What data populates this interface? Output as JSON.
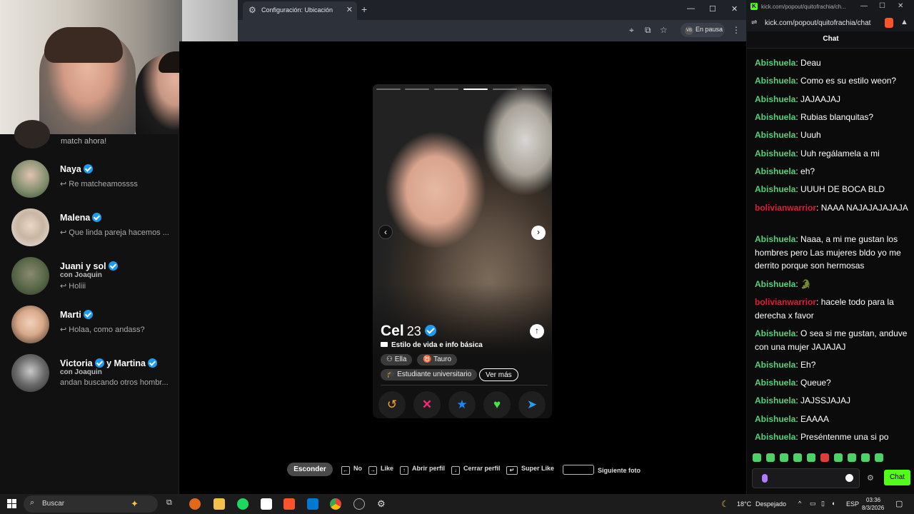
{
  "browser": {
    "tab_title": "Configuración: Ubicación",
    "paused_label": "En pausa",
    "profile_initials": "VB"
  },
  "sidebar": {
    "top_text": "match ahora!",
    "conversations": [
      {
        "name": "Naya",
        "sub": "",
        "message": "↩ Re matcheamossss",
        "verified": true
      },
      {
        "name": "Malena",
        "sub": "",
        "message": "↩ Que linda pareja hacemos ...",
        "verified": true
      },
      {
        "name": "Juani y sol",
        "sub": "con Joaquin",
        "message": "↩ Holiii",
        "verified": true
      },
      {
        "name": "Marti",
        "sub": "",
        "message": "↩ Holaa, como andass?",
        "verified": true
      },
      {
        "name": "Victoria",
        "name2": "y Martina",
        "sub": "con Joaquin",
        "message": "andan buscando otros hombr...",
        "verified": true
      }
    ]
  },
  "profile": {
    "name": "Cel",
    "age": "23",
    "lifestyle": "Estilo de vida e info básica",
    "chips": [
      "Ella",
      "Tauro",
      "Estudiante universitario"
    ],
    "more_label": "Ver más",
    "photo_count": 6,
    "active_photo": 4
  },
  "actions": [
    "rewind-icon",
    "nope-icon",
    "superlike-icon",
    "like-icon",
    "boost-icon"
  ],
  "shortcuts": {
    "hide": "Esconder",
    "no": "No",
    "like": "Like",
    "open_profile": "Abrir perfil",
    "close_profile": "Cerrar perfil",
    "super_like": "Super Like",
    "next_photo": "Siguiente foto"
  },
  "chat": {
    "url": "kick.com/popout/quitofrachia/chat",
    "window_title": "kick.com/popout/quitofrachia/ch...",
    "header": "Chat",
    "messages": [
      {
        "user": "Abishuela",
        "color": "green",
        "text": ": Deau"
      },
      {
        "user": "Abishuela",
        "color": "green",
        "text": ": Como es su estilo weon?"
      },
      {
        "user": "Abishuela",
        "color": "green",
        "text": ": JAJAAJAJ"
      },
      {
        "user": "Abishuela",
        "color": "green",
        "text": ": Rubias blanquitas?"
      },
      {
        "user": "Abishuela",
        "color": "green",
        "text": ": Uuuh"
      },
      {
        "user": "Abishuela",
        "color": "green",
        "text": ": Uuh regálamela a mi"
      },
      {
        "user": "Abishuela",
        "color": "green",
        "text": ": eh?"
      },
      {
        "user": "Abishuela",
        "color": "green",
        "text": ": UUUH DE BOCA BLD"
      },
      {
        "user": "bolivianwarrior",
        "color": "red",
        "text": ": NAAA NAJAJAJAJAJA"
      },
      {
        "user": "Abishuela",
        "color": "green",
        "text": ": Naaa, a mi me gustan los hombres pero Las mujeres bldo yo me derrito porque son hermosas"
      },
      {
        "user": "Abishuela",
        "color": "green",
        "text": ": 🐊"
      },
      {
        "user": "bolivianwarrior",
        "color": "red",
        "text": ": hacele todo para la derecha x favor"
      },
      {
        "user": "Abishuela",
        "color": "green",
        "text": ": O sea si me gustan, anduve con una mujer JAJAJAJ"
      },
      {
        "user": "Abishuela",
        "color": "green",
        "text": ": Eh?"
      },
      {
        "user": "Abishuela",
        "color": "green",
        "text": ": Queue?"
      },
      {
        "user": "Abishuela",
        "color": "green",
        "text": ": JAJSSJAJAJ"
      },
      {
        "user": "Abishuela",
        "color": "green",
        "text": ": EAAAA"
      },
      {
        "user": "Abishuela",
        "color": "green",
        "text": ": Preséntenme una si po"
      }
    ],
    "send_label": "Chat"
  },
  "taskbar": {
    "search_placeholder": "Buscar",
    "weather": "18°C",
    "weather_desc": "Despejado",
    "lang": "ESP",
    "time": "03:36",
    "date": "8/3/2026"
  },
  "colors": {
    "kick_green": "#53fc18",
    "chat_user_green": "#53d27b",
    "chat_user_red": "#e01c3a",
    "verified_blue": "#1d9bf0"
  }
}
